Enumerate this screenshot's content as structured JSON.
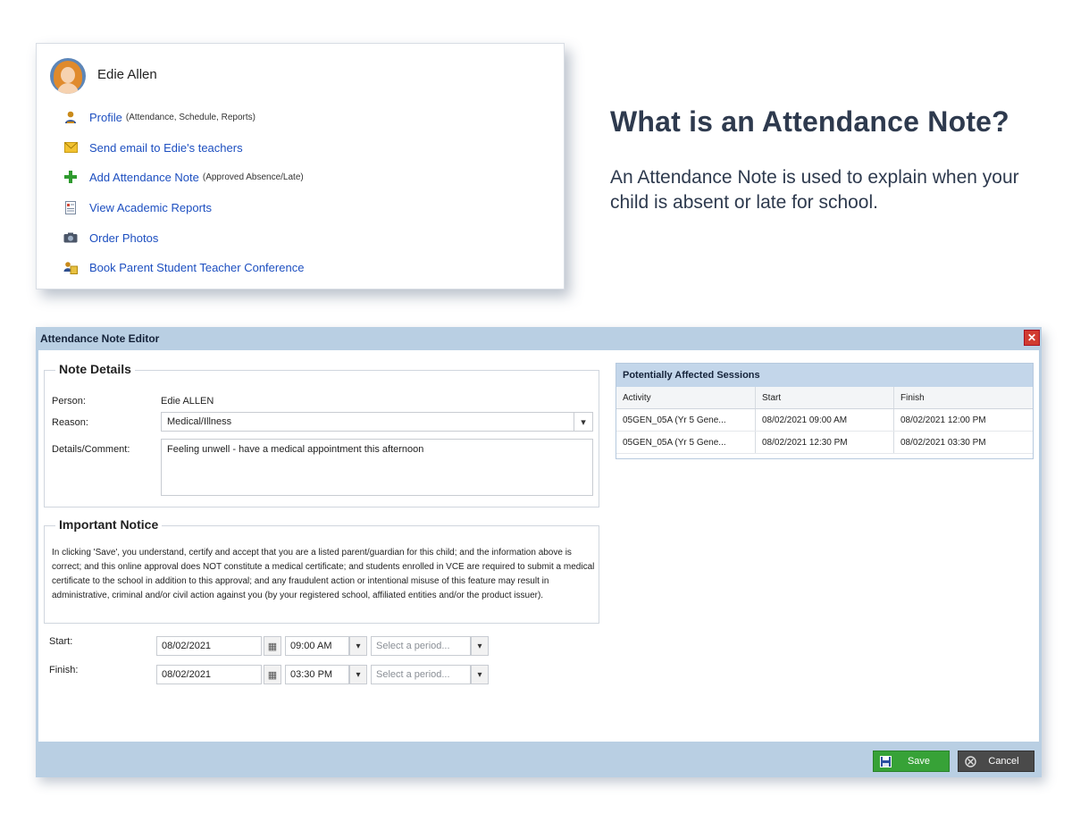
{
  "profile": {
    "name": "Edie Allen",
    "links": [
      {
        "label": "Profile",
        "sub": "(Attendance, Schedule, Reports)",
        "icon": "person-icon"
      },
      {
        "label": "Send email to Edie's teachers",
        "sub": "",
        "icon": "envelope-icon"
      },
      {
        "label": "Add Attendance Note",
        "sub": "(Approved Absence/Late)",
        "icon": "plus-icon"
      },
      {
        "label": "View Academic Reports",
        "sub": "",
        "icon": "report-icon"
      },
      {
        "label": "Order Photos",
        "sub": "",
        "icon": "camera-icon"
      },
      {
        "label": "Book Parent Student Teacher Conference",
        "sub": "",
        "icon": "conference-icon"
      }
    ]
  },
  "info": {
    "headline": "What is an Attendance Note?",
    "description": "An Attendance Note is used to explain when your child is absent or late for school."
  },
  "editor": {
    "title": "Attendance Note Editor",
    "note_details": {
      "legend": "Note Details",
      "person_label": "Person:",
      "person_value": "Edie ALLEN",
      "reason_label": "Reason:",
      "reason_value": "Medical/Illness",
      "details_label": "Details/Comment:",
      "details_value": "Feeling unwell - have a medical appointment this afternoon"
    },
    "notice": {
      "legend": "Important Notice",
      "text": "In clicking 'Save', you understand, certify and accept that you are a listed parent/guardian for this child; and the information above is correct; and this online approval does NOT constitute a medical certificate; and students enrolled in VCE are required to submit a medical certificate to the school in addition to this approval; and any fraudulent action or intentional misuse of this feature may result in administrative, criminal and/or civil action against you (by your registered school, affiliated entities and/or the product issuer)."
    },
    "start": {
      "label": "Start:",
      "date": "08/02/2021",
      "time": "09:00 AM",
      "period_placeholder": "Select a period..."
    },
    "finish": {
      "label": "Finish:",
      "date": "08/02/2021",
      "time": "03:30 PM",
      "period_placeholder": "Select a period..."
    },
    "sessions": {
      "title": "Potentially Affected Sessions",
      "columns": [
        "Activity",
        "Start",
        "Finish"
      ],
      "rows": [
        [
          "05GEN_05A (Yr 5 Gene...",
          "08/02/2021 09:00 AM",
          "08/02/2021 12:00 PM"
        ],
        [
          "05GEN_05A (Yr 5 Gene...",
          "08/02/2021 12:30 PM",
          "08/02/2021 03:30 PM"
        ]
      ]
    },
    "buttons": {
      "save": "Save",
      "cancel": "Cancel"
    }
  },
  "colors": {
    "link": "#1d4fc0",
    "window_chrome": "#b9cfe3",
    "save_button": "#37a237",
    "cancel_button": "#4a4a4a",
    "close_button": "#d13b30"
  }
}
